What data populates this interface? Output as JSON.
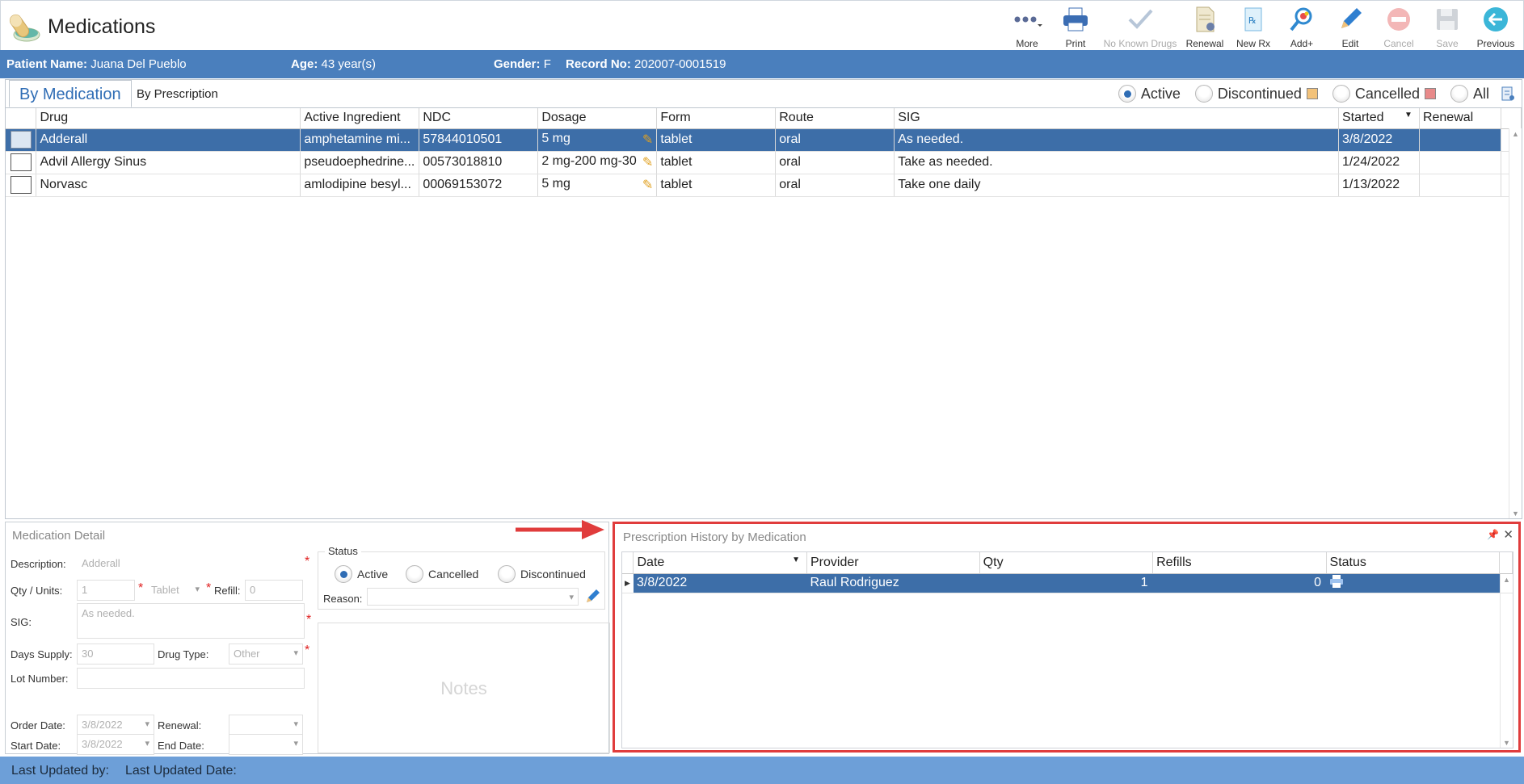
{
  "app": {
    "title": "Medications"
  },
  "toolbar": [
    {
      "label": "More",
      "icon": "more-icon",
      "disabled": false
    },
    {
      "label": "Print",
      "icon": "printer-icon",
      "disabled": false
    },
    {
      "label": "No Known Drugs",
      "icon": "checkmark-icon",
      "disabled": true
    },
    {
      "label": "Renewal",
      "icon": "renewal-document-icon",
      "disabled": false
    },
    {
      "label": "New Rx",
      "icon": "new-rx-icon",
      "disabled": false
    },
    {
      "label": "Add+",
      "icon": "magnifier-add-icon",
      "disabled": false
    },
    {
      "label": "Edit",
      "icon": "pencil-icon",
      "disabled": false
    },
    {
      "label": "Cancel",
      "icon": "no-entry-icon",
      "disabled": true
    },
    {
      "label": "Save",
      "icon": "floppy-disk-icon",
      "disabled": true
    },
    {
      "label": "Previous",
      "icon": "back-arrow-icon",
      "disabled": false
    }
  ],
  "patient": {
    "name_label": "Patient Name:",
    "name": "Juana Del Pueblo",
    "age_label": "Age:",
    "age": "43 year(s)",
    "gender_label": "Gender:",
    "gender": "F",
    "record_label": "Record No:",
    "record": "202007-0001519"
  },
  "tabs": [
    {
      "label": "By Medication"
    },
    {
      "label": "By Prescription"
    }
  ],
  "filters": [
    {
      "label": "Active",
      "selected": true,
      "color": ""
    },
    {
      "label": "Discontinued",
      "selected": false,
      "color": "#f2c27a"
    },
    {
      "label": "Cancelled",
      "selected": false,
      "color": "#e88a8a"
    },
    {
      "label": "All",
      "selected": false,
      "color": ""
    }
  ],
  "med_grid": {
    "columns": [
      "Drug",
      "Active Ingredient",
      "NDC",
      "Dosage",
      "Form",
      "Route",
      "SIG",
      "Started",
      "Renewal"
    ],
    "rows": [
      {
        "drug": "Adderall",
        "ingredient": "amphetamine mi...",
        "ndc": "57844010501",
        "dosage": "5 mg",
        "form": "tablet",
        "route": "oral",
        "sig": "As needed.",
        "started": "3/8/2022",
        "renewal": ""
      },
      {
        "drug": "Advil Allergy Sinus",
        "ingredient": "pseudoephedrine...",
        "ndc": "00573018810",
        "dosage": "2 mg-200 mg-30",
        "form": "tablet",
        "route": "oral",
        "sig": "Take as needed.",
        "started": "1/24/2022",
        "renewal": ""
      },
      {
        "drug": "Norvasc",
        "ingredient": "amlodipine besyl...",
        "ndc": "00069153072",
        "dosage": "5 mg",
        "form": "tablet",
        "route": "oral",
        "sig": "Take one daily",
        "started": "1/13/2022",
        "renewal": ""
      }
    ]
  },
  "detail": {
    "title": "Medication Detail",
    "description_label": "Description:",
    "description": "Adderall",
    "qty_label": "Qty / Units:",
    "qty": "1",
    "units": "Tablet",
    "refill_label": "Refill:",
    "refill": "0",
    "sig_label": "SIG:",
    "sig": "As needed.",
    "days_label": "Days Supply:",
    "days": "30",
    "drugtype_label": "Drug Type:",
    "drugtype": "Other",
    "lot_label": "Lot Number:",
    "lot": "",
    "order_label": "Order Date:",
    "order_date": "3/8/2022",
    "renewal_label": "Renewal:",
    "renewal": "",
    "start_label": "Start Date:",
    "start_date": "3/8/2022",
    "end_label": "End Date:",
    "end_date": "",
    "status_legend": "Status",
    "status_options": [
      {
        "label": "Active",
        "selected": true
      },
      {
        "label": "Cancelled",
        "selected": false
      },
      {
        "label": "Discontinued",
        "selected": false
      }
    ],
    "reason_label": "Reason:",
    "reason": "",
    "notes_label": "Notes",
    "required_mark": "*"
  },
  "history": {
    "title": "Prescription History by Medication",
    "pin": "📌",
    "close": "✕",
    "columns": [
      "Date",
      "Provider",
      "Qty",
      "Refills",
      "Status"
    ],
    "rows": [
      {
        "date": "3/8/2022",
        "provider": "Raul Rodriguez",
        "qty": "1",
        "refills": "0"
      }
    ]
  },
  "footer": {
    "updated_by_label": "Last Updated by:",
    "updated_date_label": "Last Updated Date:"
  }
}
